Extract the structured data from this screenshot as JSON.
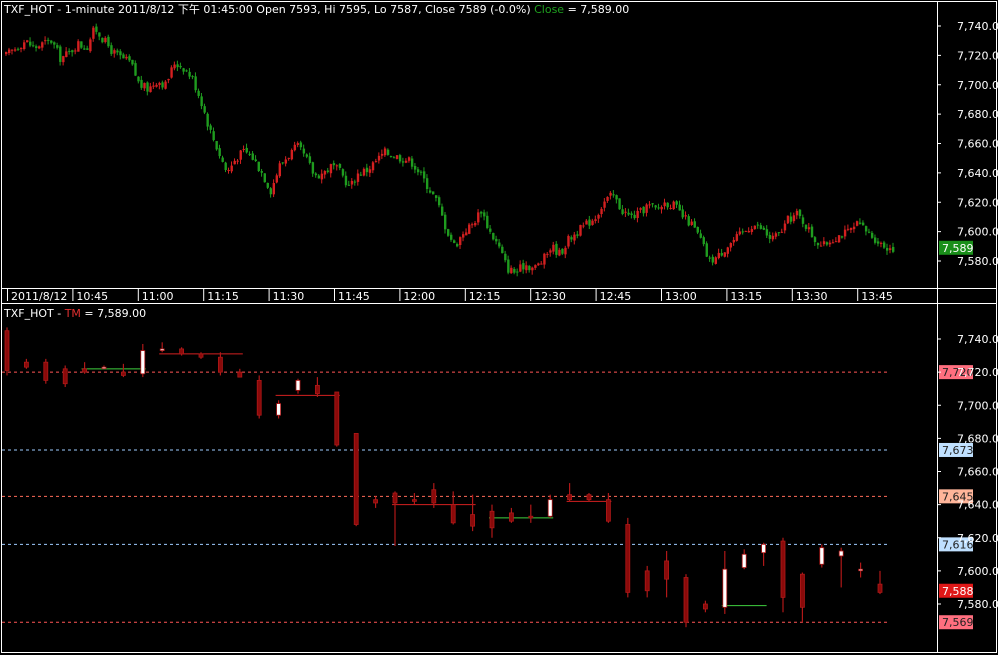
{
  "colors": {
    "background": "#000000",
    "frame": "#ffffff",
    "up_candle": "#d42020",
    "down_candle": "#1f9c1f",
    "tm_candle": "#b01818",
    "tm_body_up": "#ffffff",
    "tm_body_down": "#8a0a0a",
    "last_price_tag": "#1a8f1a"
  },
  "price_panel": {
    "header": {
      "symbol": "TXF_HOT",
      "interval": "1-minute",
      "datetime": "2011/8/12 下午 01:45:00",
      "open_label": "Open 7593,",
      "hi_label": "Hi 7595,",
      "lo_label": "Lo 7587,",
      "close_label": "Close 7589 (-0.0%)",
      "indicator_name": "Close",
      "indicator_value": "= 7,589.00"
    },
    "last_price_tag": "7,589"
  },
  "tm_panel": {
    "header": {
      "symbol": "TXF_HOT -",
      "indicator_name": "TM",
      "indicator_value": "= 7,589.00"
    }
  },
  "chart_data": [
    {
      "type": "candlestick",
      "title": "TXF_HOT - 1-minute 2011/8/12",
      "ylim": [
        7565,
        7750
      ],
      "y_ticks": [
        "7,740.0",
        "7,720.0",
        "7,700.0",
        "7,680.0",
        "7,660.0",
        "7,640.0",
        "7,620.0",
        "7,600.0",
        "7,580.0"
      ],
      "y_tick_values": [
        7740,
        7720,
        7700,
        7680,
        7660,
        7640,
        7620,
        7600,
        7580
      ],
      "time_labels": [
        "2011/8/12",
        "10:45",
        "11:00",
        "11:15",
        "11:30",
        "11:45",
        "12:00",
        "12:15",
        "12:30",
        "12:45",
        "13:00",
        "13:15",
        "13:30",
        "13:45"
      ],
      "close_path": [
        [
          8.45,
          7720
        ],
        [
          9.0,
          7730
        ],
        [
          9.25,
          7725
        ],
        [
          9.5,
          7728
        ],
        [
          9.75,
          7730
        ],
        [
          10.0,
          7718
        ],
        [
          10.25,
          7722
        ],
        [
          10.5,
          7728
        ],
        [
          10.75,
          7725
        ],
        [
          10.9,
          7735
        ],
        [
          11.0,
          7738
        ],
        [
          11.25,
          7730
        ],
        [
          11.5,
          7722
        ],
        [
          11.75,
          7718
        ],
        [
          12.0,
          7715
        ],
        [
          12.25,
          7700
        ],
        [
          12.5,
          7697
        ],
        [
          12.75,
          7703
        ],
        [
          13.0,
          7700
        ],
        [
          13.25,
          7715
        ],
        [
          13.5,
          7712
        ],
        [
          13.75,
          7705
        ],
        [
          14.0,
          7690
        ],
        [
          14.25,
          7670
        ],
        [
          14.5,
          7655
        ],
        [
          14.75,
          7640
        ],
        [
          15.0,
          7650
        ],
        [
          15.25,
          7655
        ],
        [
          15.5,
          7650
        ],
        [
          15.75,
          7640
        ],
        [
          16.0,
          7628
        ],
        [
          16.25,
          7645
        ],
        [
          16.5,
          7652
        ],
        [
          16.75,
          7658
        ],
        [
          17.0,
          7650
        ],
        [
          17.25,
          7638
        ],
        [
          17.5,
          7640
        ],
        [
          17.75,
          7645
        ],
        [
          18.0,
          7640
        ],
        [
          18.25,
          7630
        ],
        [
          18.5,
          7640
        ],
        [
          18.75,
          7642
        ],
        [
          19.0,
          7648
        ],
        [
          19.25,
          7654
        ],
        [
          19.5,
          7652
        ],
        [
          19.75,
          7650
        ],
        [
          20.0,
          7648
        ],
        [
          20.25,
          7640
        ],
        [
          20.5,
          7630
        ],
        [
          20.75,
          7620
        ],
        [
          21.0,
          7602
        ],
        [
          21.25,
          7590
        ],
        [
          21.5,
          7600
        ],
        [
          21.75,
          7605
        ],
        [
          22.0,
          7615
        ],
        [
          22.25,
          7600
        ],
        [
          22.5,
          7590
        ],
        [
          22.75,
          7575
        ],
        [
          23.0,
          7572
        ],
        [
          23.25,
          7578
        ],
        [
          23.5,
          7575
        ],
        [
          23.75,
          7580
        ],
        [
          24.0,
          7590
        ],
        [
          24.25,
          7585
        ],
        [
          24.5,
          7595
        ],
        [
          24.75,
          7600
        ],
        [
          25.0,
          7605
        ],
        [
          25.25,
          7610
        ],
        [
          25.5,
          7620
        ],
        [
          25.75,
          7625
        ],
        [
          26.0,
          7615
        ],
        [
          26.25,
          7610
        ],
        [
          26.5,
          7612
        ],
        [
          26.75,
          7618
        ],
        [
          27.0,
          7615
        ],
        [
          27.25,
          7620
        ],
        [
          27.5,
          7618
        ],
        [
          27.75,
          7610
        ],
        [
          28.0,
          7605
        ],
        [
          28.25,
          7595
        ],
        [
          28.5,
          7580
        ],
        [
          28.75,
          7583
        ],
        [
          29.0,
          7590
        ],
        [
          29.25,
          7595
        ],
        [
          29.5,
          7600
        ],
        [
          29.75,
          7605
        ],
        [
          30.0,
          7602
        ],
        [
          30.25,
          7595
        ],
        [
          30.5,
          7598
        ],
        [
          30.75,
          7608
        ],
        [
          31.0,
          7612
        ],
        [
          31.25,
          7605
        ],
        [
          31.5,
          7595
        ],
        [
          31.75,
          7590
        ],
        [
          32.0,
          7595
        ],
        [
          32.25,
          7598
        ],
        [
          32.5,
          7600
        ],
        [
          32.75,
          7605
        ],
        [
          33.0,
          7600
        ],
        [
          33.25,
          7595
        ],
        [
          33.5,
          7590
        ],
        [
          33.75,
          7589
        ]
      ]
    },
    {
      "type": "candlestick",
      "title": "TXF_HOT - TM",
      "ylim": [
        7565,
        7750
      ],
      "y_ticks": [
        "7,740.0",
        "7,720.0",
        "7,700.0",
        "7,680.0",
        "7,660.0",
        "7,640.0",
        "7,620.0",
        "7,600.0",
        "7,580.0"
      ],
      "y_tick_values": [
        7740,
        7720,
        7700,
        7680,
        7660,
        7640,
        7620,
        7600,
        7580
      ],
      "levels": [
        {
          "label": "7,720",
          "value": 7720,
          "color": "#ff6f7f",
          "line": "#ff5555"
        },
        {
          "label": "7,673",
          "value": 7673,
          "color": "#bfe0ff",
          "line": "#9ecbff"
        },
        {
          "label": "7,645",
          "value": 7645,
          "color": "#ffb59a",
          "line": "#ff6b5a"
        },
        {
          "label": "7,616",
          "value": 7616,
          "color": "#bfe0ff",
          "line": "#9ecbff"
        },
        {
          "label": "7,588",
          "value": 7588,
          "color": "#e01818",
          "line": null
        },
        {
          "label": "7,569",
          "value": 7569,
          "color": "#ff6f7f",
          "line": "#ff5555"
        }
      ],
      "bars": [
        [
          0,
          7745,
          7721,
          7747,
          7718
        ],
        [
          1,
          7726,
          7723,
          7728,
          7722
        ],
        [
          2,
          7726,
          7715,
          7728,
          7713
        ],
        [
          3,
          7722,
          7713,
          7724,
          7711
        ],
        [
          4,
          7722,
          7720,
          7726,
          7719
        ],
        [
          5,
          7723,
          7723,
          7724,
          7722
        ],
        [
          6,
          7720,
          7718,
          7725,
          7717
        ],
        [
          7,
          7719,
          7733,
          7737,
          7717
        ],
        [
          8,
          7733,
          7734,
          7738,
          7732
        ],
        [
          9,
          7734,
          7731,
          7735,
          7730
        ],
        [
          10,
          7731,
          7729,
          7732,
          7728
        ],
        [
          11,
          7729,
          7720,
          7732,
          7718
        ],
        [
          12,
          7720,
          7717,
          7722,
          7717
        ],
        [
          13,
          7715,
          7694,
          7718,
          7692
        ],
        [
          14,
          7694,
          7701,
          7703,
          7692
        ],
        [
          15,
          7709,
          7715,
          7716,
          7707
        ],
        [
          16,
          7712,
          7707,
          7717,
          7705
        ],
        [
          17,
          7708,
          7676,
          7708,
          7675
        ],
        [
          18,
          7683,
          7628,
          7683,
          7627
        ],
        [
          19,
          7643,
          7641,
          7645,
          7638
        ],
        [
          20,
          7647,
          7641,
          7648,
          7615
        ],
        [
          21,
          7643,
          7642,
          7647,
          7640
        ],
        [
          22,
          7649,
          7641,
          7653,
          7638
        ],
        [
          23,
          7640,
          7629,
          7648,
          7628
        ],
        [
          24,
          7634,
          7627,
          7646,
          7624
        ],
        [
          25,
          7636,
          7626,
          7640,
          7620
        ],
        [
          26,
          7635,
          7630,
          7638,
          7629
        ],
        [
          27,
          7633,
          7632,
          7640,
          7629
        ],
        [
          28,
          7633,
          7643,
          7646,
          7632
        ],
        [
          29,
          7646,
          7643,
          7653,
          7642
        ],
        [
          30,
          7646,
          7643,
          7647,
          7642
        ],
        [
          31,
          7643,
          7630,
          7647,
          7629
        ],
        [
          32,
          7628,
          7587,
          7632,
          7584
        ],
        [
          33,
          7600,
          7588,
          7603,
          7584
        ],
        [
          34,
          7606,
          7595,
          7612,
          7584
        ],
        [
          35,
          7596,
          7569,
          7598,
          7566
        ],
        [
          36,
          7580,
          7577,
          7582,
          7575
        ],
        [
          37,
          7578,
          7601,
          7612,
          7574
        ],
        [
          38,
          7602,
          7610,
          7613,
          7601
        ],
        [
          39,
          7611,
          7616,
          7617,
          7603
        ],
        [
          40,
          7618,
          7584,
          7620,
          7575
        ],
        [
          41,
          7598,
          7578,
          7599,
          7569
        ],
        [
          42,
          7604,
          7614,
          7616,
          7602
        ],
        [
          43,
          7609,
          7612,
          7614,
          7590
        ],
        [
          44,
          7601,
          7601,
          7605,
          7596
        ],
        [
          45,
          7592,
          7587,
          7600,
          7586
        ]
      ],
      "green_segments": [
        [
          4,
          7,
          7722
        ],
        [
          25,
          28,
          7632
        ],
        [
          37,
          39,
          7579
        ]
      ],
      "red_segments": [
        [
          8,
          12,
          7731
        ],
        [
          14,
          17,
          7706
        ],
        [
          20,
          24,
          7640
        ],
        [
          29,
          31,
          7642
        ]
      ]
    }
  ]
}
